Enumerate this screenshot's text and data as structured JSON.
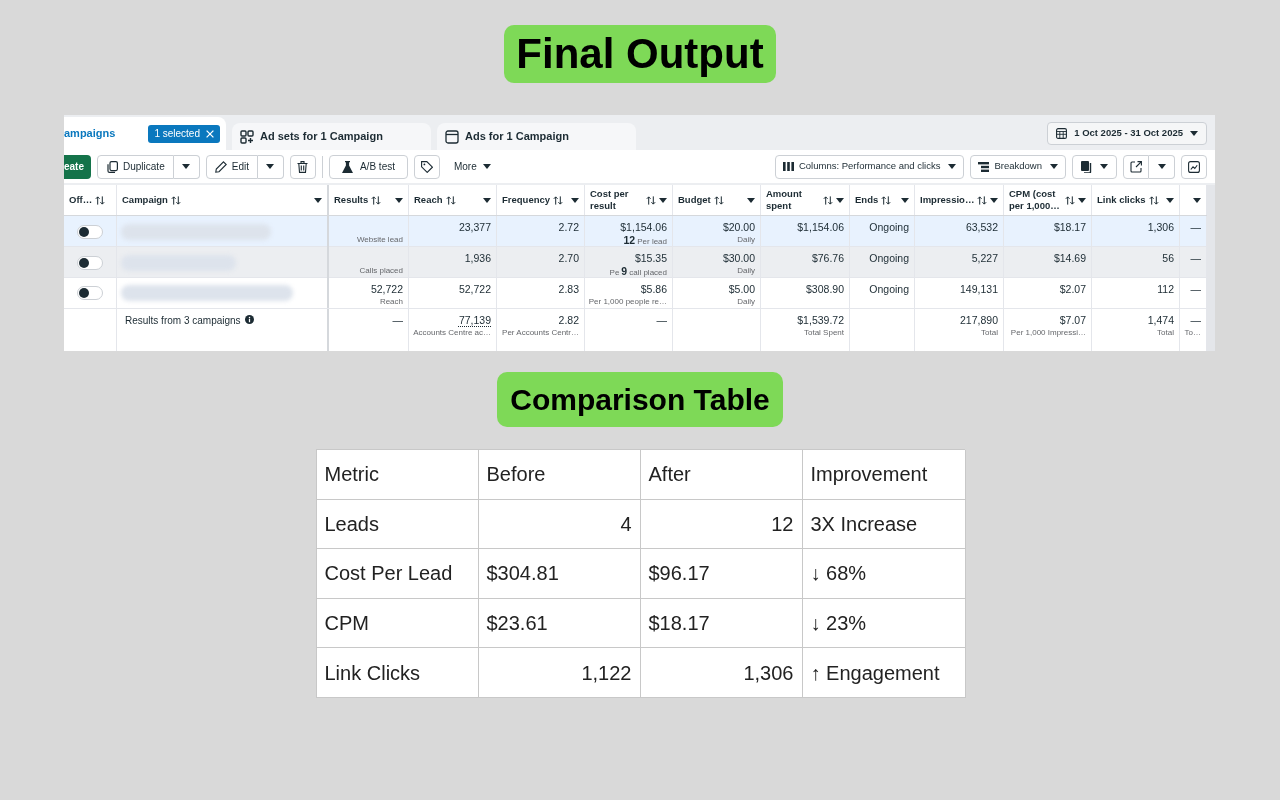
{
  "page_title": "Final Output",
  "ads_manager": {
    "tabs": [
      {
        "label": "ampaigns",
        "kind": "campaigns",
        "selected": true,
        "badge": "1 selected"
      },
      {
        "label": "Ad sets for 1 Campaign",
        "kind": "ad_sets",
        "selected": false
      },
      {
        "label": "Ads for 1 Campaign",
        "kind": "ads",
        "selected": false
      }
    ],
    "date_range": "1 Oct 2025 - 31 Oct 2025",
    "toolbar": {
      "create": "eate",
      "duplicate": "Duplicate",
      "edit": "Edit",
      "ab_test": "A/B test",
      "more": "More",
      "columns": "Columns: Performance and clicks",
      "breakdown": "Breakdown"
    },
    "table": {
      "columns": [
        {
          "label": "Off…",
          "sortable": true,
          "menu": false
        },
        {
          "label": "Campaign",
          "sortable": true,
          "menu": true
        },
        {
          "label": "Results",
          "sortable": true,
          "menu": true
        },
        {
          "label": "Reach",
          "sortable": true,
          "menu": true
        },
        {
          "label": "Frequency",
          "sortable": true,
          "menu": true
        },
        {
          "label": "Cost per result",
          "sortable": true,
          "menu": true
        },
        {
          "label": "Budget",
          "sortable": true,
          "menu": true
        },
        {
          "label": "Amount spent",
          "sortable": true,
          "menu": true
        },
        {
          "label": "Ends",
          "sortable": true,
          "menu": true
        },
        {
          "label": "Impressio…",
          "sortable": true,
          "menu": true
        },
        {
          "label": "CPM (cost per 1,000…",
          "sortable": true,
          "menu": true
        },
        {
          "label": "Link clicks",
          "sortable": true,
          "menu": true
        },
        {
          "sortable": false,
          "menu": true
        }
      ],
      "rows": [
        {
          "on": false,
          "selected": true,
          "hovered": false,
          "cells": [
            {
              "sub": "Website lead"
            },
            {
              "value": "23,377"
            },
            {
              "value": "2.72"
            },
            {
              "value": "$1,154.06",
              "sub_parts": [
                {
                  "text": "12",
                  "kind": "overlay"
                },
                {
                  "text": "Per lead",
                  "kind": "label"
                }
              ]
            },
            {
              "value": "$20.00",
              "sub": "Daily"
            },
            {
              "value": "$1,154.06"
            },
            {
              "value": "Ongoing"
            },
            {
              "value": "63,532"
            },
            {
              "value": "$18.17"
            },
            {
              "value": "1,306"
            },
            {
              "value": "—"
            }
          ]
        },
        {
          "on": false,
          "selected": false,
          "hovered": true,
          "cells": [
            {
              "sub": "Calls placed"
            },
            {
              "value": "1,936"
            },
            {
              "value": "2.70"
            },
            {
              "value": "$15.35",
              "sub_parts": [
                {
                  "text": "Pe",
                  "kind": "label"
                },
                {
                  "text": "9",
                  "kind": "overlay"
                },
                {
                  "text": "call placed",
                  "kind": "label"
                }
              ]
            },
            {
              "value": "$30.00",
              "sub": "Daily"
            },
            {
              "value": "$76.76"
            },
            {
              "value": "Ongoing"
            },
            {
              "value": "5,227"
            },
            {
              "value": "$14.69"
            },
            {
              "value": "56"
            },
            {
              "value": "—"
            }
          ]
        },
        {
          "on": false,
          "selected": false,
          "hovered": false,
          "cells": [
            {
              "value": "52,722",
              "sub": "Reach"
            },
            {
              "value": "52,722"
            },
            {
              "value": "2.83"
            },
            {
              "value": "$5.86",
              "sub": "Per 1,000 people re…"
            },
            {
              "value": "$5.00",
              "sub": "Daily"
            },
            {
              "value": "$308.90"
            },
            {
              "value": "Ongoing"
            },
            {
              "value": "149,131"
            },
            {
              "value": "$2.07"
            },
            {
              "value": "112"
            },
            {
              "value": "—"
            }
          ]
        }
      ],
      "summary": {
        "label": "Results from 3 campaigns",
        "cells": [
          {
            "value": "—"
          },
          {
            "value": "77,139",
            "underlined": true,
            "sub": "Accounts Centre ac…"
          },
          {
            "value": "2.82",
            "sub": "Per Accounts Centr…"
          },
          {
            "value": "—"
          },
          {},
          {
            "value": "$1,539.72",
            "sub": "Total Spent"
          },
          {},
          {
            "value": "217,890",
            "sub": "Total"
          },
          {
            "value": "$7.07",
            "sub": "Per 1,000 Impressi…"
          },
          {
            "value": "1,474",
            "sub": "Total"
          },
          {
            "value": "—",
            "sub": "To…"
          }
        ]
      }
    }
  },
  "comparison": {
    "title": "Comparison Table",
    "columns": [
      "Metric",
      "Before",
      "After",
      "Improvement"
    ],
    "rows": [
      [
        {
          "text": "Leads",
          "kind": "text"
        },
        {
          "text": "4",
          "kind": "number"
        },
        {
          "text": "12",
          "kind": "number"
        },
        {
          "text": "3X Increase",
          "kind": "text"
        }
      ],
      [
        {
          "text": "Cost Per Lead",
          "kind": "text"
        },
        {
          "text": "$304.81",
          "kind": "text"
        },
        {
          "text": "$96.17",
          "kind": "text"
        },
        {
          "text": "↓ 68%",
          "kind": "text"
        }
      ],
      [
        {
          "text": "CPM",
          "kind": "text"
        },
        {
          "text": "$23.61",
          "kind": "text"
        },
        {
          "text": "$18.17",
          "kind": "text"
        },
        {
          "text": "↓ 23%",
          "kind": "text"
        }
      ],
      [
        {
          "text": "Link Clicks",
          "kind": "text"
        },
        {
          "text": "1,122",
          "kind": "number"
        },
        {
          "text": "1,306",
          "kind": "number"
        },
        {
          "text": "↑ Engagement",
          "kind": "text"
        }
      ]
    ]
  }
}
